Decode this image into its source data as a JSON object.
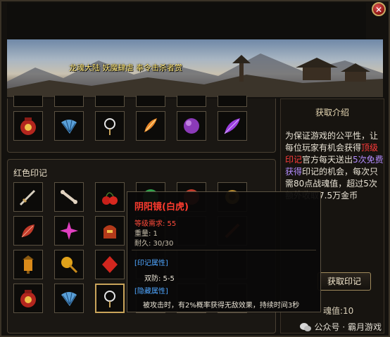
{
  "window": {
    "close_symbol": "✕"
  },
  "banner": {
    "text": "龙魂大陆 妖魔肆虐 奉令击杀者赏"
  },
  "sections": {
    "red_seal_title": "红色印记"
  },
  "info": {
    "title": "获取介绍",
    "paragraph_parts": [
      "为保证游戏的公平性，让每位玩家有机会获得",
      "顶级印记",
      "官方每天送出",
      "5次免费获得",
      "印记的机会，每次只需80点战魂值，超过5次额外收取7.5万金币"
    ],
    "get_button": "获取印记",
    "spirit_value": "魂值:10"
  },
  "tooltip": {
    "name": "阴阳镜(白虎)",
    "level_req": "等级需求: 55",
    "weight": "重量: 1",
    "durability": "耐久: 30/30",
    "attr_header": "[印记属性]",
    "attr_value": "双防: 5-5",
    "hidden_header": "[隐藏属性]",
    "hidden_desc": "被攻击时，有2%概率获得无敌效果，持续时间3秒"
  },
  "watermark": {
    "text": "公众号 · 霸月游戏"
  },
  "colors": {
    "accent_gold": "#c9a45a",
    "red_text": "#ff3b3b",
    "purple_text": "#b38cff",
    "blue_header": "#4fa6ff"
  }
}
